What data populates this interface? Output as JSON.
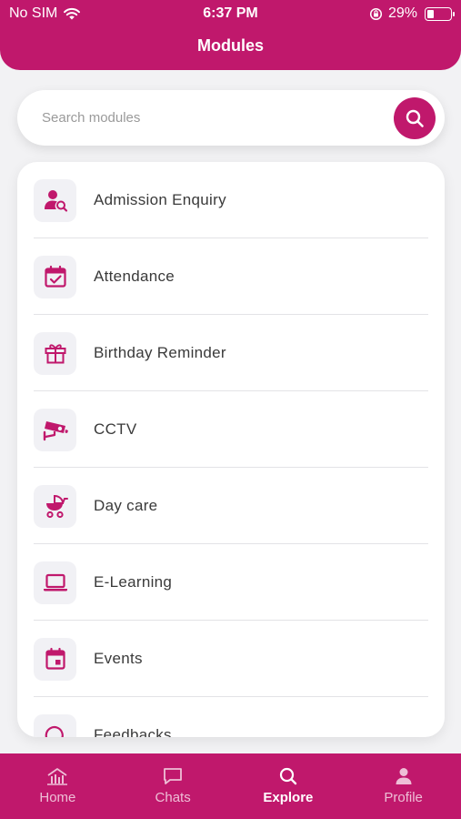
{
  "status_bar": {
    "carrier": "No SIM",
    "time": "6:37 PM",
    "battery_percent": "29%",
    "battery_level": 0.29
  },
  "header": {
    "title": "Modules"
  },
  "search": {
    "placeholder": "Search modules",
    "value": ""
  },
  "modules": [
    {
      "label": "Admission Enquiry",
      "icon": "user-search-icon"
    },
    {
      "label": "Attendance",
      "icon": "calendar-check-icon"
    },
    {
      "label": "Birthday Reminder",
      "icon": "gift-icon"
    },
    {
      "label": "CCTV",
      "icon": "cctv-camera-icon"
    },
    {
      "label": "Day care",
      "icon": "baby-stroller-icon"
    },
    {
      "label": "E-Learning",
      "icon": "laptop-icon"
    },
    {
      "label": "Events",
      "icon": "calendar-event-icon"
    },
    {
      "label": "Feedbacks",
      "icon": "feedback-icon"
    }
  ],
  "tabs": [
    {
      "label": "Home",
      "icon": "home-chart-icon",
      "active": false
    },
    {
      "label": "Chats",
      "icon": "chat-bubble-icon",
      "active": false
    },
    {
      "label": "Explore",
      "icon": "search-icon",
      "active": true
    },
    {
      "label": "Profile",
      "icon": "person-icon",
      "active": false
    }
  ],
  "colors": {
    "primary": "#c0186c",
    "background": "#f2f2f4",
    "icon_bg": "#f1f1f5"
  }
}
